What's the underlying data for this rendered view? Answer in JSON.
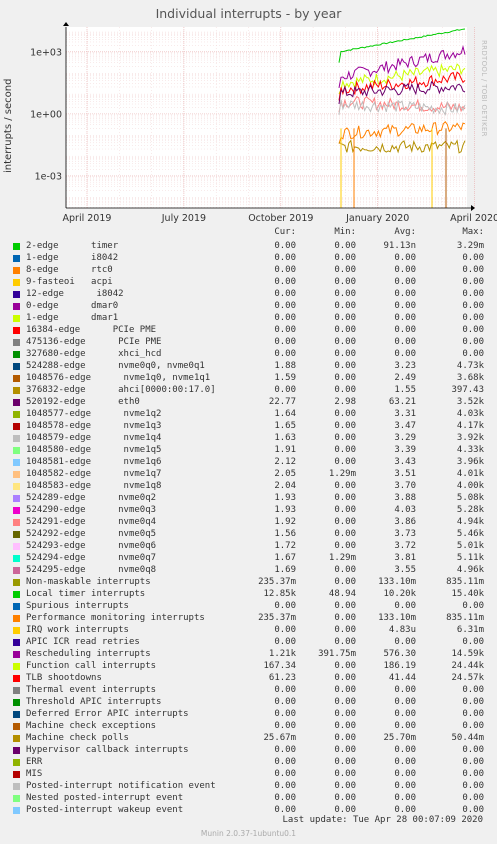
{
  "chart_data": {
    "type": "line",
    "title": "Individual interrupts - by year",
    "ylabel": "interrupts / second",
    "yscale": "log",
    "yticks": [
      "1e+03",
      "1e+00",
      "1e-03"
    ],
    "xticks": [
      "April 2019",
      "July 2019",
      "October 2019",
      "January 2020",
      "April 2020"
    ],
    "side_label": "RRDTOOL / TOBI OETIKER",
    "grid": true,
    "columns": [
      "Cur:",
      "Min:",
      "Avg:",
      "Max:"
    ],
    "series": [
      {
        "name": "2-edge      timer",
        "color": "#00cc00",
        "values": [
          "0.00",
          "0.00",
          "91.13n",
          "3.29m"
        ]
      },
      {
        "name": "1-edge      i8042",
        "color": "#0066b3",
        "values": [
          "0.00",
          "0.00",
          "0.00",
          "0.00"
        ]
      },
      {
        "name": "8-edge      rtc0",
        "color": "#ff8000",
        "values": [
          "0.00",
          "0.00",
          "0.00",
          "0.00"
        ]
      },
      {
        "name": "9-fasteoi   acpi",
        "color": "#ffcc00",
        "values": [
          "0.00",
          "0.00",
          "0.00",
          "0.00"
        ]
      },
      {
        "name": "12-edge      i8042",
        "color": "#330099",
        "values": [
          "0.00",
          "0.00",
          "0.00",
          "0.00"
        ]
      },
      {
        "name": "0-edge      dmar0",
        "color": "#990099",
        "values": [
          "0.00",
          "0.00",
          "0.00",
          "0.00"
        ]
      },
      {
        "name": "1-edge      dmar1",
        "color": "#ccff00",
        "values": [
          "0.00",
          "0.00",
          "0.00",
          "0.00"
        ]
      },
      {
        "name": "16384-edge      PCIe PME",
        "color": "#ff0000",
        "values": [
          "0.00",
          "0.00",
          "0.00",
          "0.00"
        ]
      },
      {
        "name": "475136-edge      PCIe PME",
        "color": "#808080",
        "values": [
          "0.00",
          "0.00",
          "0.00",
          "0.00"
        ]
      },
      {
        "name": "327680-edge      xhci_hcd",
        "color": "#008f00",
        "values": [
          "0.00",
          "0.00",
          "0.00",
          "0.00"
        ]
      },
      {
        "name": "524288-edge      nvme0q0, nvme0q1",
        "color": "#00487d",
        "values": [
          "1.88",
          "0.00",
          "3.23",
          "4.73k"
        ]
      },
      {
        "name": "1048576-edge      nvme1q0, nvme1q1",
        "color": "#b35a00",
        "values": [
          "1.59",
          "0.00",
          "2.49",
          "3.68k"
        ]
      },
      {
        "name": "376832-edge      ahci[0000:00:17.0]",
        "color": "#b38f00",
        "values": [
          "0.00",
          "0.00",
          "1.55",
          "397.43"
        ]
      },
      {
        "name": "520192-edge      eth0",
        "color": "#6b006b",
        "values": [
          "22.77",
          "2.98",
          "63.21",
          "3.52k"
        ]
      },
      {
        "name": "1048577-edge      nvme1q2",
        "color": "#8fb300",
        "values": [
          "1.64",
          "0.00",
          "3.31",
          "4.03k"
        ]
      },
      {
        "name": "1048578-edge      nvme1q3",
        "color": "#b30000",
        "values": [
          "1.65",
          "0.00",
          "3.47",
          "4.17k"
        ]
      },
      {
        "name": "1048579-edge      nvme1q4",
        "color": "#bebebe",
        "values": [
          "1.63",
          "0.00",
          "3.29",
          "3.92k"
        ]
      },
      {
        "name": "1048580-edge      nvme1q5",
        "color": "#80ff80",
        "values": [
          "1.91",
          "0.00",
          "3.39",
          "4.33k"
        ]
      },
      {
        "name": "1048581-edge      nvme1q6",
        "color": "#80c9ff",
        "values": [
          "2.12",
          "0.00",
          "3.43",
          "3.96k"
        ]
      },
      {
        "name": "1048582-edge      nvme1q7",
        "color": "#ffc080",
        "values": [
          "2.05",
          "1.29m",
          "3.51",
          "4.01k"
        ]
      },
      {
        "name": "1048583-edge      nvme1q8",
        "color": "#ffe680",
        "values": [
          "2.04",
          "0.00",
          "3.70",
          "4.00k"
        ]
      },
      {
        "name": "524289-edge      nvme0q2",
        "color": "#aa80ff",
        "values": [
          "1.93",
          "0.00",
          "3.88",
          "5.08k"
        ]
      },
      {
        "name": "524290-edge      nvme0q3",
        "color": "#ee00cc",
        "values": [
          "1.93",
          "0.00",
          "4.03",
          "5.28k"
        ]
      },
      {
        "name": "524291-edge      nvme0q4",
        "color": "#ff8080",
        "values": [
          "1.92",
          "0.00",
          "3.86",
          "4.94k"
        ]
      },
      {
        "name": "524292-edge      nvme0q5",
        "color": "#666600",
        "values": [
          "1.56",
          "0.00",
          "3.73",
          "5.46k"
        ]
      },
      {
        "name": "524293-edge      nvme0q6",
        "color": "#ffbfff",
        "values": [
          "1.72",
          "0.00",
          "3.72",
          "5.01k"
        ]
      },
      {
        "name": "524294-edge      nvme0q7",
        "color": "#00ffcc",
        "values": [
          "1.67",
          "1.29m",
          "3.81",
          "5.11k"
        ]
      },
      {
        "name": "524295-edge      nvme0q8",
        "color": "#cc6699",
        "values": [
          "1.69",
          "0.00",
          "3.55",
          "4.96k"
        ]
      },
      {
        "name": "Non-maskable interrupts",
        "color": "#999900",
        "values": [
          "235.37m",
          "0.00",
          "133.10m",
          "835.11m"
        ]
      },
      {
        "name": "Local timer interrupts",
        "color": "#00cc00",
        "values": [
          "12.85k",
          "48.94",
          "10.20k",
          "15.40k"
        ]
      },
      {
        "name": "Spurious interrupts",
        "color": "#0066b3",
        "values": [
          "0.00",
          "0.00",
          "0.00",
          "0.00"
        ]
      },
      {
        "name": "Performance monitoring interrupts",
        "color": "#ff8000",
        "values": [
          "235.37m",
          "0.00",
          "133.10m",
          "835.11m"
        ]
      },
      {
        "name": "IRQ work interrupts",
        "color": "#ffcc00",
        "values": [
          "0.00",
          "0.00",
          "4.83u",
          "6.31m"
        ]
      },
      {
        "name": "APIC ICR read retries",
        "color": "#330099",
        "values": [
          "0.00",
          "0.00",
          "0.00",
          "0.00"
        ]
      },
      {
        "name": "Rescheduling interrupts",
        "color": "#990099",
        "values": [
          "1.21k",
          "391.75m",
          "576.30",
          "14.59k"
        ]
      },
      {
        "name": "Function call interrupts",
        "color": "#ccff00",
        "values": [
          "167.34",
          "0.00",
          "186.19",
          "24.44k"
        ]
      },
      {
        "name": "TLB shootdowns",
        "color": "#ff0000",
        "values": [
          "61.23",
          "0.00",
          "41.44",
          "24.57k"
        ]
      },
      {
        "name": "Thermal event interrupts",
        "color": "#808080",
        "values": [
          "0.00",
          "0.00",
          "0.00",
          "0.00"
        ]
      },
      {
        "name": "Threshold APIC interrupts",
        "color": "#008f00",
        "values": [
          "0.00",
          "0.00",
          "0.00",
          "0.00"
        ]
      },
      {
        "name": "Deferred Error APIC interrupts",
        "color": "#00487d",
        "values": [
          "0.00",
          "0.00",
          "0.00",
          "0.00"
        ]
      },
      {
        "name": "Machine check exceptions",
        "color": "#b35a00",
        "values": [
          "0.00",
          "0.00",
          "0.00",
          "0.00"
        ]
      },
      {
        "name": "Machine check polls",
        "color": "#b38f00",
        "values": [
          "25.67m",
          "0.00",
          "25.70m",
          "50.44m"
        ]
      },
      {
        "name": "Hypervisor callback interrupts",
        "color": "#6b006b",
        "values": [
          "0.00",
          "0.00",
          "0.00",
          "0.00"
        ]
      },
      {
        "name": "ERR",
        "color": "#8fb300",
        "values": [
          "0.00",
          "0.00",
          "0.00",
          "0.00"
        ]
      },
      {
        "name": "MIS",
        "color": "#b30000",
        "values": [
          "0.00",
          "0.00",
          "0.00",
          "0.00"
        ]
      },
      {
        "name": "Posted-interrupt notification event",
        "color": "#bebebe",
        "values": [
          "0.00",
          "0.00",
          "0.00",
          "0.00"
        ]
      },
      {
        "name": "Nested posted-interrupt event",
        "color": "#80ff80",
        "values": [
          "0.00",
          "0.00",
          "0.00",
          "0.00"
        ]
      },
      {
        "name": "Posted-interrupt wakeup event",
        "color": "#80c9ff",
        "values": [
          "0.00",
          "0.00",
          "0.00",
          "0.00"
        ]
      }
    ],
    "plotted_levels": [
      {
        "color": "#00cc00",
        "start": 1000,
        "end": 12850
      },
      {
        "color": "#990099",
        "start": 60,
        "end": 1210
      },
      {
        "color": "#ccff00",
        "start": 30,
        "end": 167
      },
      {
        "color": "#ff0000",
        "start": 15,
        "end": 61
      },
      {
        "color": "#6b006b",
        "start": 10,
        "end": 22.77
      },
      {
        "color": "#ff8080",
        "start": 4,
        "end": 1.9
      },
      {
        "color": "#bebebe",
        "start": 3,
        "end": 1.7
      },
      {
        "color": "#ff8000",
        "start": 0.12,
        "end": 0.235
      },
      {
        "color": "#b38f00",
        "start": 0.026,
        "end": 0.026
      }
    ]
  },
  "last_update": "Last update: Tue Apr 28 00:07:09 2020",
  "footer": "Munin 2.0.37-1ubuntu0.1"
}
